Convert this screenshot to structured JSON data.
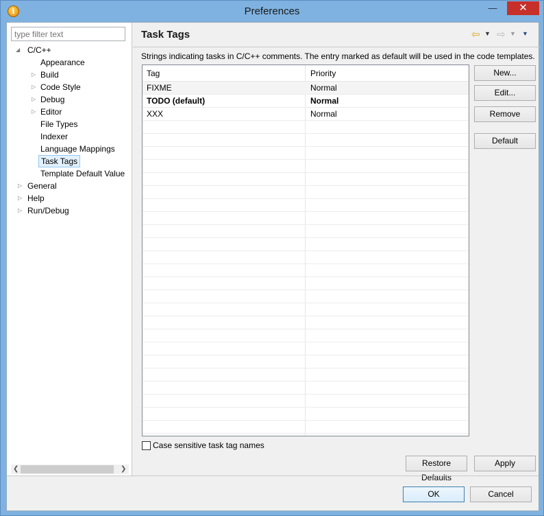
{
  "window": {
    "title": "Preferences",
    "close_glyph": "✕",
    "min_glyph": "—",
    "max_glyph": "☐"
  },
  "filter": {
    "placeholder": "type filter text"
  },
  "tree": {
    "cpp": "C/C++",
    "appearance": "Appearance",
    "build": "Build",
    "code_style": "Code Style",
    "debug": "Debug",
    "editor": "Editor",
    "file_types": "File Types",
    "indexer": "Indexer",
    "language_mappings": "Language Mappings",
    "task_tags": "Task Tags",
    "template_default_value": "Template Default Value",
    "general": "General",
    "help": "Help",
    "run_debug": "Run/Debug"
  },
  "page": {
    "title": "Task Tags",
    "description": "Strings indicating tasks in C/C++ comments. The entry marked as default will be used in the code templates."
  },
  "table": {
    "headers": [
      "Tag",
      "Priority"
    ],
    "rows": [
      {
        "tag": "FIXME",
        "priority": "Normal",
        "default": false
      },
      {
        "tag": "TODO (default)",
        "priority": "Normal",
        "default": true
      },
      {
        "tag": "XXX",
        "priority": "Normal",
        "default": false
      }
    ]
  },
  "buttons": {
    "new": "New...",
    "edit": "Edit...",
    "remove": "Remove",
    "default": "Default",
    "restore_defaults": "Restore Defaults",
    "apply": "Apply",
    "ok": "OK",
    "cancel": "Cancel"
  },
  "checkbox": {
    "label": "Case sensitive task tag names",
    "checked": false
  },
  "colors": {
    "accent": "#3c7fb1",
    "close": "#c7302a",
    "frame": "#7fb2e0"
  }
}
